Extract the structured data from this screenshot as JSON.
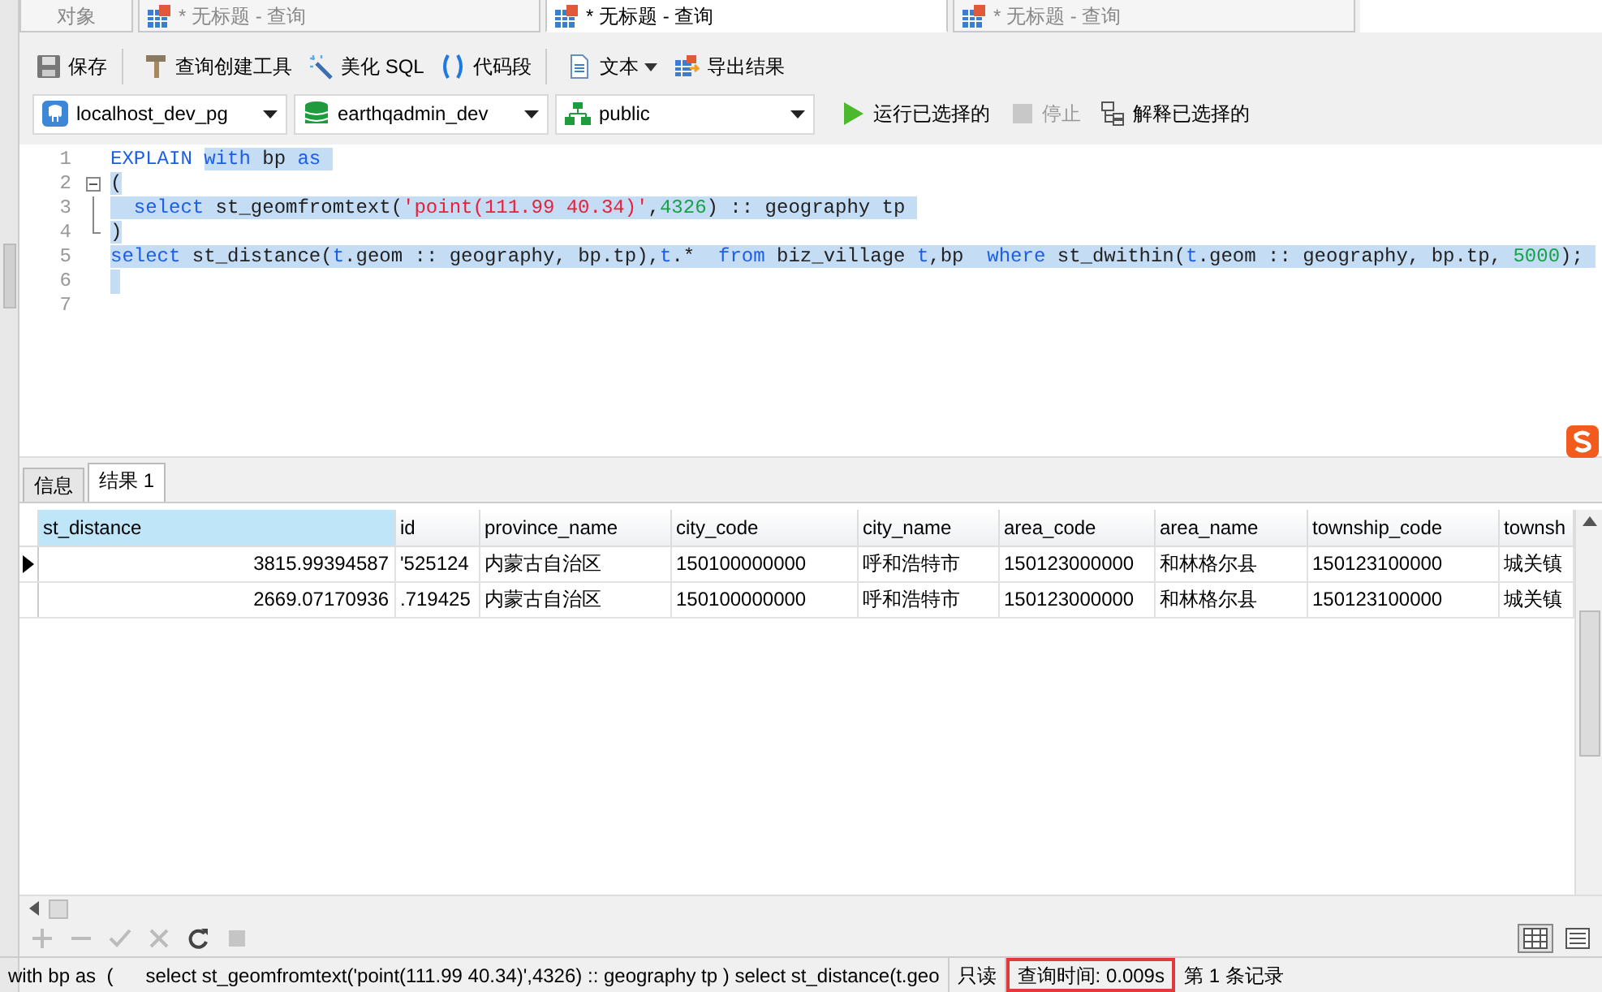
{
  "tabs": [
    {
      "label": "对象",
      "kind": "plain",
      "selected": false
    },
    {
      "label": "* 无标题 - 查询",
      "kind": "query",
      "selected": false
    },
    {
      "label": "* 无标题 - 查询",
      "kind": "query",
      "selected": true
    },
    {
      "label": "* 无标题 - 查询",
      "kind": "query",
      "selected": false
    }
  ],
  "toolbar": [
    {
      "label": "保存",
      "dropdown": false,
      "separator_after": true
    },
    {
      "label": "查询创建工具",
      "dropdown": false,
      "separator_after": false
    },
    {
      "label": "美化 SQL",
      "dropdown": false,
      "separator_after": false
    },
    {
      "label": "代码段",
      "dropdown": false,
      "separator_after": true
    },
    {
      "label": "文本",
      "dropdown": true,
      "separator_after": false
    },
    {
      "label": "导出结果",
      "dropdown": false,
      "separator_after": false
    }
  ],
  "selectors": [
    {
      "value": "localhost_dev_pg"
    },
    {
      "value": "earthqadmin_dev"
    },
    {
      "value": "public"
    }
  ],
  "actions": [
    {
      "label": "运行已选择的",
      "disabled": false
    },
    {
      "label": "停止",
      "disabled": true
    },
    {
      "label": "解释已选择的",
      "disabled": false
    }
  ],
  "editor": {
    "lines": [
      {
        "number": "1",
        "kind": "plain",
        "tokens": [
          {
            "text": "EXPLAIN ",
            "kind": "keyword",
            "selected": false
          },
          {
            "text": "with",
            "kind": "keyword",
            "selected": true
          },
          {
            "text": " bp ",
            "kind": "plain",
            "selected": true
          },
          {
            "text": "as ",
            "kind": "keyword",
            "selected": true
          }
        ]
      },
      {
        "number": "2",
        "kind": "fold-start",
        "tokens": [
          {
            "text": "(",
            "kind": "plain",
            "selected": true
          }
        ]
      },
      {
        "number": "3",
        "kind": "fold-body",
        "tokens": [
          {
            "text": "  select",
            "kind": "keyword",
            "selected": true
          },
          {
            "text": " st_geomfromtext(",
            "kind": "plain",
            "selected": true
          },
          {
            "text": "'point(111.99 40.34)'",
            "kind": "string",
            "selected": true
          },
          {
            "text": ",",
            "kind": "plain",
            "selected": true
          },
          {
            "text": "4326",
            "kind": "number",
            "selected": true
          },
          {
            "text": ") :: geography tp ",
            "kind": "plain",
            "selected": true
          }
        ]
      },
      {
        "number": "4",
        "kind": "fold-end",
        "tokens": [
          {
            "text": ")",
            "kind": "plain",
            "selected": true
          }
        ]
      },
      {
        "number": "5",
        "kind": "plain",
        "tokens": [
          {
            "text": "select",
            "kind": "keyword",
            "selected": true
          },
          {
            "text": " st_distance(",
            "kind": "plain",
            "selected": true
          },
          {
            "text": "t",
            "kind": "keyword",
            "selected": true
          },
          {
            "text": ".geom :: geography, bp.tp),",
            "kind": "plain",
            "selected": true
          },
          {
            "text": "t",
            "kind": "keyword",
            "selected": true
          },
          {
            "text": ".*  ",
            "kind": "plain",
            "selected": true
          },
          {
            "text": "from",
            "kind": "keyword",
            "selected": true
          },
          {
            "text": " biz_village ",
            "kind": "plain",
            "selected": true
          },
          {
            "text": "t",
            "kind": "keyword",
            "selected": true
          },
          {
            "text": ",bp  ",
            "kind": "plain",
            "selected": true
          },
          {
            "text": "where",
            "kind": "keyword",
            "selected": true
          },
          {
            "text": " st_dwithin(",
            "kind": "plain",
            "selected": true
          },
          {
            "text": "t",
            "kind": "keyword",
            "selected": true
          },
          {
            "text": ".geom :: geography, bp.tp, ",
            "kind": "plain",
            "selected": true
          },
          {
            "text": "5000",
            "kind": "number",
            "selected": true
          },
          {
            "text": "); ",
            "kind": "plain",
            "selected": true
          }
        ]
      },
      {
        "number": "6",
        "kind": "plain",
        "selected": true
      },
      {
        "number": "7",
        "kind": "plain"
      }
    ]
  },
  "result_tabs": [
    {
      "label": "信息",
      "selected": false
    },
    {
      "label": "结果 1",
      "selected": true
    }
  ],
  "table": {
    "columns": [
      {
        "label": "st_distance",
        "selected": true
      },
      {
        "label": "id",
        "selected": false
      },
      {
        "label": "province_name",
        "selected": false
      },
      {
        "label": "city_code",
        "selected": false
      },
      {
        "label": "city_name",
        "selected": false
      },
      {
        "label": "area_code",
        "selected": false
      },
      {
        "label": "area_name",
        "selected": false
      },
      {
        "label": "township_code",
        "selected": false
      },
      {
        "label": "townsh",
        "selected": false
      }
    ],
    "rows": [
      {
        "current": true,
        "cells": [
          "3815.99394587",
          "'525124",
          "内蒙古自治区",
          "150100000000",
          "呼和浩特市",
          "150123000000",
          "和林格尔县",
          "150123100000",
          "城关镇"
        ]
      },
      {
        "current": false,
        "cells": [
          "2669.07170936",
          ".719425",
          "内蒙古自治区",
          "150100000000",
          "呼和浩特市",
          "150123000000",
          "和林格尔县",
          "150123100000",
          "城关镇"
        ]
      }
    ]
  },
  "grid_tools": [
    {
      "disabled": true
    },
    {
      "disabled": true
    },
    {
      "disabled": true
    },
    {
      "disabled": true
    },
    {
      "disabled": false
    },
    {
      "disabled": true
    }
  ],
  "views": [
    {
      "selected": true
    },
    {
      "selected": false
    }
  ],
  "status_bar": [
    {
      "text": "with bp as  (      select st_geomfromtext('point(111.99 40.34)',4326) :: geography tp ) select st_distance(t.geo",
      "highlighted": false
    },
    {
      "text": "只读",
      "highlighted": false
    },
    {
      "text": "查询时间: 0.009s",
      "highlighted": true
    },
    {
      "text": "第 1 条记录",
      "highlighted": false
    }
  ]
}
